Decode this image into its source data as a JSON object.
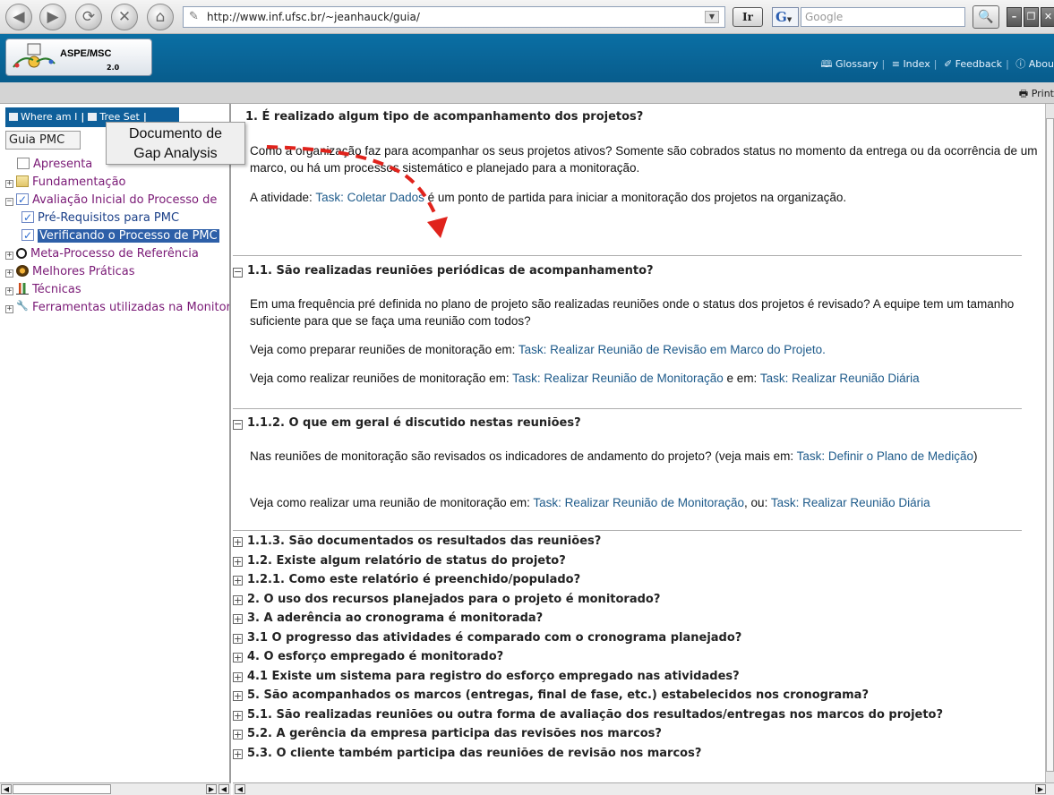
{
  "browser": {
    "url": "http://www.inf.ufsc.br/~jeanhauck/guia/",
    "go_label": "Ir",
    "search_placeholder": "Google"
  },
  "header": {
    "logo_text": "ASPE/MSC",
    "logo_version": "2.0",
    "links": [
      {
        "icon": "book-icon",
        "label": "Glossary"
      },
      {
        "icon": "list-icon",
        "label": "Index"
      },
      {
        "icon": "pen-icon",
        "label": "Feedback"
      },
      {
        "icon": "info-icon",
        "label": "Abou"
      }
    ],
    "print_label": "Print"
  },
  "left_pane": {
    "tabs": [
      "Where am I",
      "Tree Set"
    ],
    "view_select": "Guia PMC",
    "callout": "Documento de Gap Analysis",
    "tree": [
      {
        "label": "Apresenta",
        "icon": "document-icon",
        "expand": null,
        "level": 0
      },
      {
        "label": "Fundamentação",
        "icon": "folder-icon",
        "expand": "+",
        "level": 0
      },
      {
        "label": "Avaliação Inicial do Processo de",
        "icon": "checklist-icon",
        "expand": "−",
        "level": 0
      },
      {
        "label": "Pré-Requisitos para PMC",
        "icon": "checklist-icon",
        "expand": null,
        "level": 1
      },
      {
        "label": "Verificando o Processo de PMC",
        "icon": "checklist-icon",
        "expand": null,
        "level": 1,
        "selected": true
      },
      {
        "label": "Meta-Processo de Referência",
        "icon": "cycle-icon",
        "expand": "+",
        "level": 0
      },
      {
        "label": "Melhores Práticas",
        "icon": "flower-icon",
        "expand": "+",
        "level": 0
      },
      {
        "label": "Técnicas",
        "icon": "chart-icon",
        "expand": "+",
        "level": 0
      },
      {
        "label": "Ferramentas utilizadas na Monitoração",
        "icon": "tool-icon",
        "expand": "+",
        "level": 0
      }
    ]
  },
  "main": {
    "sections": [
      {
        "title": "1. É realizado algum tipo de acompanhamento dos projetos?",
        "paragraphs": [
          [
            {
              "t": "Como a organização faz para acompanhar os seus projetos ativos? Somente são cobrados status no momento da entrega ou da ocorrência de um marco, ou há um processos sistemático e planejado para a monitoração."
            }
          ],
          [
            {
              "t": "A atividade: "
            },
            {
              "t": "Task: Coletar Dados",
              "link": true
            },
            {
              "t": " é um ponto de partida para iniciar a monitoração dos projetos na organização."
            }
          ]
        ]
      },
      {
        "title": "1.1. São realizadas reuniões periódicas de acompanhamento?",
        "paragraphs": [
          [
            {
              "t": "Em uma frequência pré definida no plano de projeto são realizadas reuniões onde o status dos projetos é revisado? A equipe tem um tamanho suficiente para que se faça uma reunião com todos?"
            }
          ],
          [
            {
              "t": "Veja como preparar reuniões de monitoração em: "
            },
            {
              "t": "Task: Realizar Reunião de Revisão em Marco do Projeto.",
              "link": true
            }
          ],
          [
            {
              "t": "Veja como realizar reuniões de monitoração em: "
            },
            {
              "t": "Task: Realizar Reunião de Monitoração",
              "link": true
            },
            {
              "t": " e em: "
            },
            {
              "t": "Task: Realizar Reunião Diária",
              "link": true
            }
          ]
        ]
      },
      {
        "title": "1.1.2. O que em geral é discutido nestas reuniões?",
        "paragraphs": [
          [
            {
              "t": "Nas reuniões de monitoração são revisados os indicadores de andamento do projeto? (veja mais em: "
            },
            {
              "t": "Task: Definir o Plano de Medição",
              "link": true
            },
            {
              "t": ")"
            }
          ],
          [
            {
              "t": "Veja como realizar uma reunião de monitoração em: "
            },
            {
              "t": "Task: Realizar Reunião de Monitoração",
              "link": true
            },
            {
              "t": ", ou: "
            },
            {
              "t": "Task: Realizar Reunião Diária",
              "link": true
            }
          ]
        ]
      }
    ],
    "collapsed_items": [
      "1.1.3. São documentados os resultados das reuniões?",
      "1.2. Existe algum relatório de status do projeto?",
      "1.2.1. Como este relatório é preenchido/populado?",
      "2. O uso dos recursos planejados para o projeto é monitorado?",
      "3. A aderência ao cronograma é monitorada?",
      "3.1 O progresso das atividades é comparado com o cronograma planejado?",
      "4. O esforço empregado é monitorado?",
      "4.1 Existe um sistema para registro do esforço empregado nas atividades?",
      "5. São acompanhados os marcos (entregas, final de fase, etc.) estabelecidos nos cronograma?",
      "5.1. São realizadas reuniões ou outra forma de avaliação dos resultados/entregas nos marcos do projeto?",
      "5.2. A gerência da empresa participa das revisões nos marcos?",
      "5.3. O cliente também participa das reuniões de revisão nos marcos?"
    ]
  },
  "colors": {
    "header_blue": "#0b6fa4",
    "link": "#1d5a8a",
    "tree_label": "#7a1a76",
    "tree_selected": "#2d5fa8",
    "arrow": "#e0231c"
  }
}
